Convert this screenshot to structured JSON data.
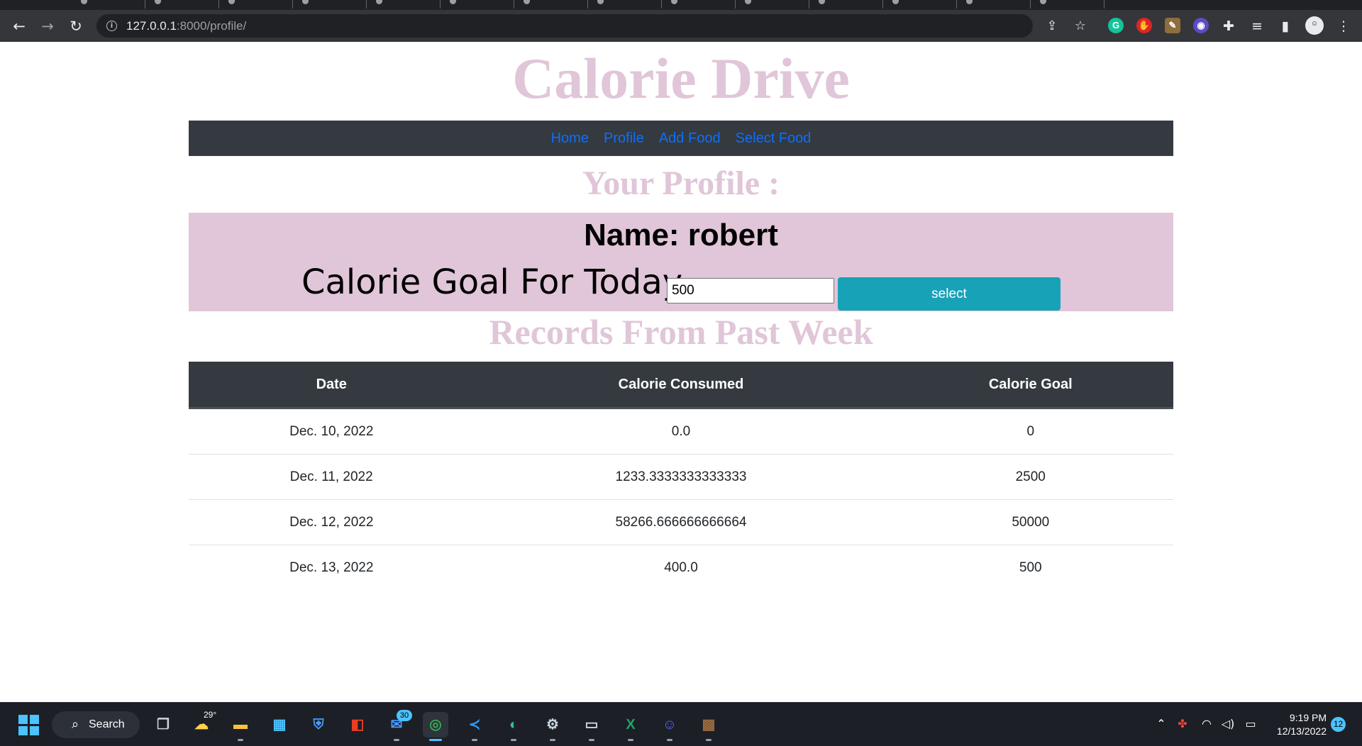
{
  "browser": {
    "url_host": "127.0.0.1",
    "url_rest": ":8000/profile/",
    "icons": [
      "back-icon",
      "forward-icon",
      "reload-icon",
      "site-info-icon",
      "share-icon",
      "bookmark-star-icon",
      "grammarly-icon",
      "extension-icon",
      "puzzle-icon",
      "reading-list-icon",
      "side-panel-icon",
      "profile-avatar-icon",
      "menu-kebab-icon"
    ]
  },
  "site": {
    "title": "Calorie Drive",
    "accent_color": "#e0c6d8"
  },
  "nav": {
    "items": [
      {
        "label": "Home"
      },
      {
        "label": "Profile"
      },
      {
        "label": "Add Food"
      },
      {
        "label": "Select Food"
      }
    ]
  },
  "profile": {
    "heading": "Your Profile :",
    "name_line": "Name: robert",
    "goal_label": "Calorie Goal For Today",
    "goal_value": "500",
    "select_label": "select"
  },
  "records": {
    "heading": "Records From Past Week",
    "columns": [
      "Date",
      "Calorie Consumed",
      "Calorie Goal"
    ],
    "rows": [
      [
        "Dec. 10, 2022",
        "0.0",
        "0"
      ],
      [
        "Dec. 11, 2022",
        "1233.3333333333333",
        "2500"
      ],
      [
        "Dec. 12, 2022",
        "58266.666666666664",
        "50000"
      ],
      [
        "Dec. 13, 2022",
        "400.0",
        "500"
      ]
    ]
  },
  "taskbar": {
    "search_label": "Search",
    "weather_temp": "29°",
    "mail_badge": "30",
    "time": "9:19 PM",
    "date": "12/13/2022",
    "notification_count": "12"
  }
}
